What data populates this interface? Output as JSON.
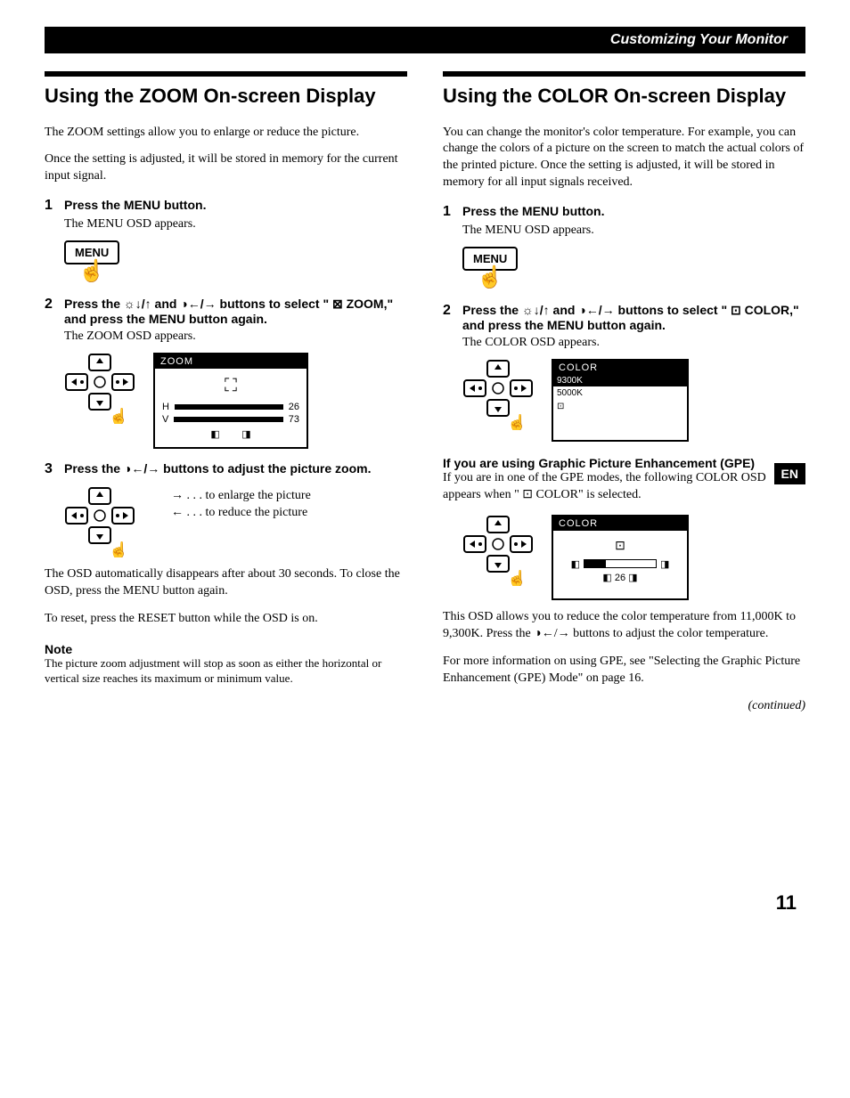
{
  "header": {
    "section_title": "Customizing Your Monitor"
  },
  "left": {
    "title": "Using the ZOOM On-screen Display",
    "intro1": "The ZOOM settings allow you to enlarge or reduce the picture.",
    "intro2": "Once the setting is adjusted, it will be stored in memory for the current input signal.",
    "step1_title": "Press the MENU button.",
    "step1_body": "The MENU OSD appears.",
    "menu_label": "MENU",
    "step2_title": "Press the ☼↓/↑ and ◑←/→ buttons to select \" ⊠ ZOOM,\" and press the MENU button again.",
    "step2_body": "The ZOOM OSD appears.",
    "osd_zoom": {
      "title": "ZOOM",
      "h_label": "H",
      "h_val": "26",
      "v_label": "V",
      "v_val": "73"
    },
    "step3_title": "Press the ◑←/→ buttons to adjust the picture zoom.",
    "arrow_right": "→ . . . to enlarge the picture",
    "arrow_left": "← . . . to reduce the picture",
    "body1": "The OSD automatically disappears after about 30 seconds. To close the OSD, press the MENU button again.",
    "body2": "To reset, press the RESET button while the OSD is on.",
    "note_head": "Note",
    "note_body": "The picture zoom adjustment will stop as soon as either the horizontal or vertical size reaches its maximum or minimum value."
  },
  "right": {
    "title": "Using the COLOR On-screen Display",
    "intro": "You can change the monitor's color temperature. For example, you can change the colors of a picture on the screen to match the actual colors of the printed picture. Once the setting is adjusted, it will be stored in memory for all input signals received.",
    "step1_title": "Press the MENU button.",
    "step1_body": "The MENU OSD appears.",
    "menu_label": "MENU",
    "step2_title": "Press the ☼↓/↑ and ◑←/→ buttons to select \" ⊡ COLOR,\" and press the MENU button again.",
    "step2_body": "The COLOR OSD appears.",
    "osd_color": {
      "title": "COLOR",
      "row1": "9300K",
      "row2": "5000K",
      "row3": "⊡"
    },
    "en_tab": "EN",
    "gpe_head": "If you are using Graphic Picture Enhancement (GPE)",
    "gpe_body": "If you are in one of the GPE modes, the following COLOR OSD appears when \" ⊡ COLOR\" is selected.",
    "osd_gpe": {
      "title": "COLOR",
      "icon": "⊡",
      "val": "26"
    },
    "body1": "This OSD allows you to reduce the color temperature from 11,000K to 9,300K. Press the ◑←/→ buttons to adjust the color temperature.",
    "body2": "For more information on using GPE, see \"Selecting the Graphic Picture Enhancement (GPE) Mode\" on page 16.",
    "continued": "(continued)"
  },
  "page_number": "11"
}
